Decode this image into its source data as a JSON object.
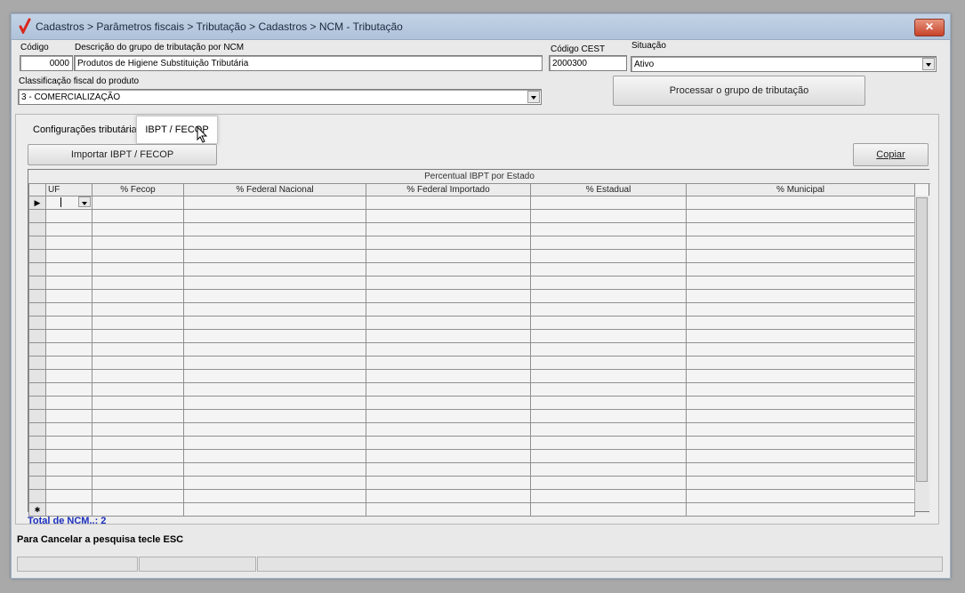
{
  "window": {
    "title": "Cadastros > Parâmetros fiscais > Tributação > Cadastros > NCM - Tributação",
    "close_glyph": "✕"
  },
  "form": {
    "codigo_label": "Código",
    "codigo_value": "0000",
    "descricao_label": "Descrição do grupo de tributação por NCM",
    "descricao_value": "Produtos de Higiene Substituição Tributária",
    "cest_label": "Código CEST",
    "cest_value": "2000300",
    "situacao_label": "Situação",
    "situacao_value": "Ativo",
    "classificacao_label": "Classificação fiscal do produto",
    "classificacao_value": "3 - COMERCIALIZAÇÃO",
    "processar_button": "Processar o grupo de tributação"
  },
  "tabs": {
    "config_label": "Configurações tributárias",
    "ibpt_label": "IBPT / FECOP"
  },
  "actions": {
    "importar_button": "Importar IBPT / FECOP",
    "copiar_button": "Copiar"
  },
  "grid": {
    "title": "Percentual IBPT por Estado",
    "columns": [
      "UF",
      "% Fecop",
      "% Federal Nacional",
      "% Federal Importado",
      "% Estadual",
      "% Municipal"
    ],
    "row_indicator": "▶",
    "new_row_indicator": "✱"
  },
  "footer": {
    "total_label": "Total de NCM..: 2",
    "hint": "Para Cancelar a pesquisa tecle ESC"
  },
  "colors": {
    "total_text": "#1a2fbf",
    "titlebar": "#b7c9de",
    "close_button": "#c7432a",
    "app_icon": "#d9261c"
  },
  "icons": [
    "app-checkmark-icon",
    "close-icon",
    "chevron-down-icon",
    "row-pointer-icon",
    "mouse-cursor-icon"
  ]
}
